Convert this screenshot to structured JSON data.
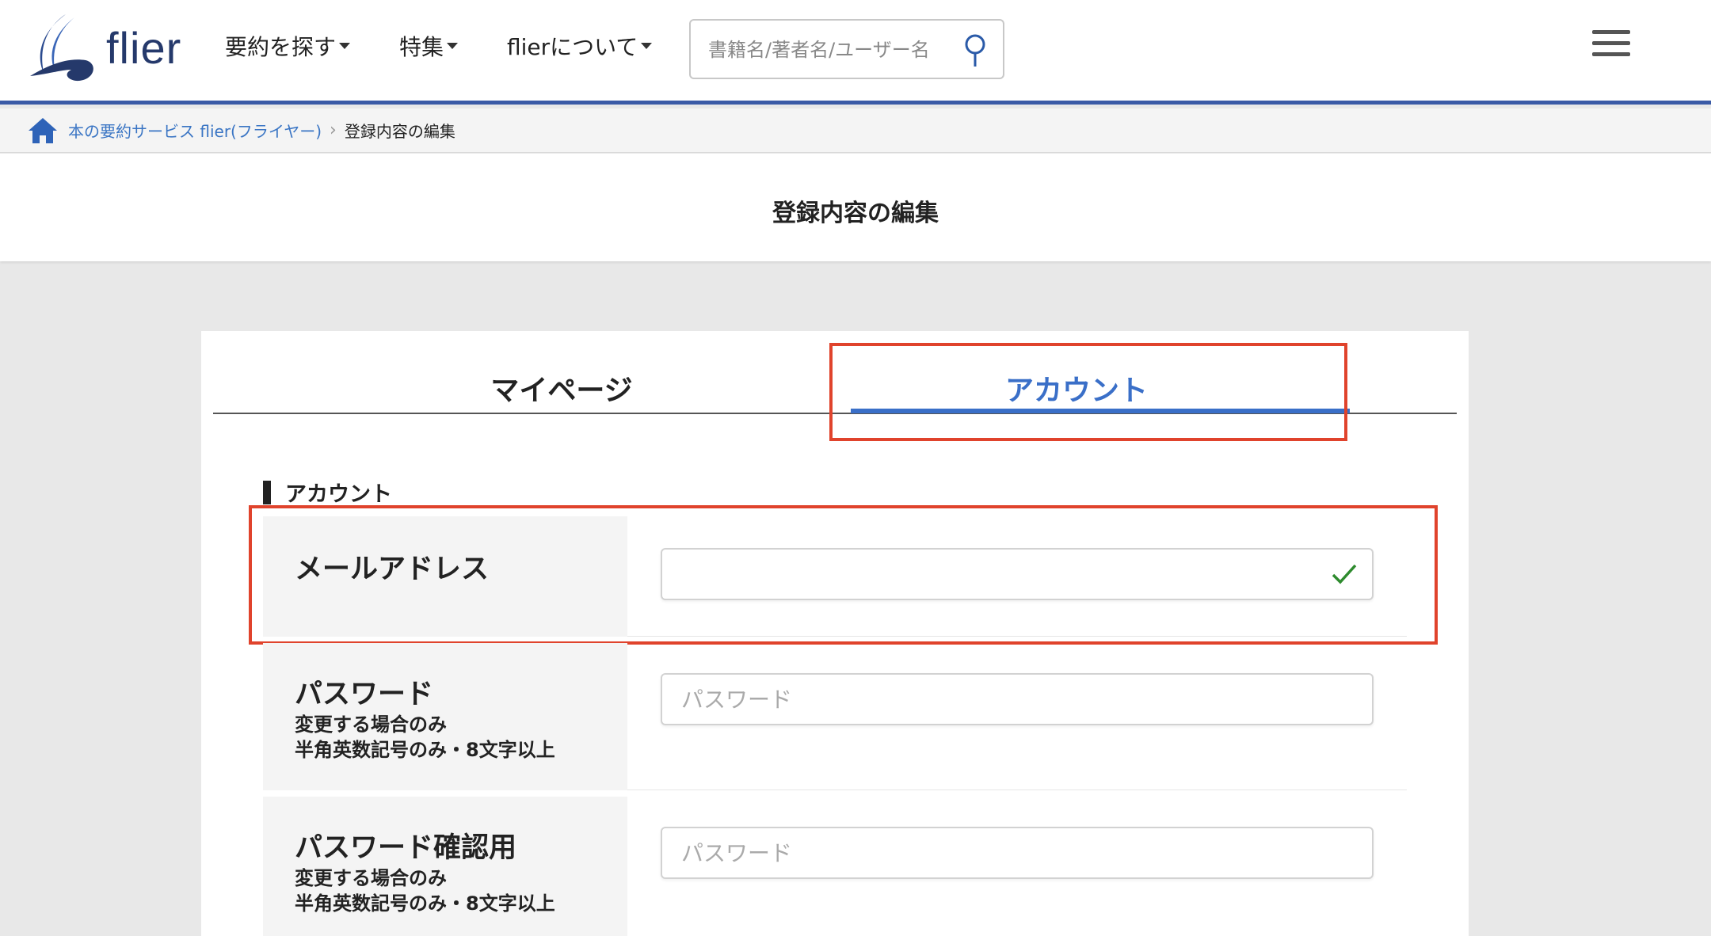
{
  "brand": {
    "name": "flier",
    "logo_color": "#25396b",
    "accent": "#3a5aa6",
    "icon": "flier-logo-icon"
  },
  "nav": {
    "items": [
      {
        "label": "要約を探す",
        "icon": "caret-down-icon"
      },
      {
        "label": "特集",
        "icon": "caret-down-icon"
      },
      {
        "label": "flierについて",
        "icon": "caret-down-icon"
      }
    ]
  },
  "search": {
    "placeholder": "書籍名/著者名/ユーザー名",
    "icon": "search-icon"
  },
  "menu": {
    "icon": "hamburger-menu-icon"
  },
  "breadcrumb": {
    "home_icon": "home-icon",
    "link": "本の要約サービス flier(フライヤー)",
    "separator_icon": "chevron-right-icon",
    "current": "登録内容の編集"
  },
  "page": {
    "title": "登録内容の編集"
  },
  "tabs": [
    {
      "label": "マイページ",
      "active": false
    },
    {
      "label": "アカウント",
      "active": true
    }
  ],
  "section": {
    "label": "アカウント"
  },
  "form": {
    "email": {
      "label": "メールアドレス",
      "value": "",
      "status_icon": "checkmark-icon",
      "status_color": "#2e8b2e"
    },
    "password": {
      "label": "パスワード",
      "sub1": "変更する場合のみ",
      "sub2": "半角英数記号のみ・8文字以上",
      "placeholder": "パスワード"
    },
    "password_confirm": {
      "label": "パスワード確認用",
      "sub1": "変更する場合のみ",
      "sub2": "半角英数記号のみ・8文字以上",
      "placeholder": "パスワード"
    }
  },
  "highlight_color": "#e0432c",
  "active_tab_color": "#3a6fc8"
}
